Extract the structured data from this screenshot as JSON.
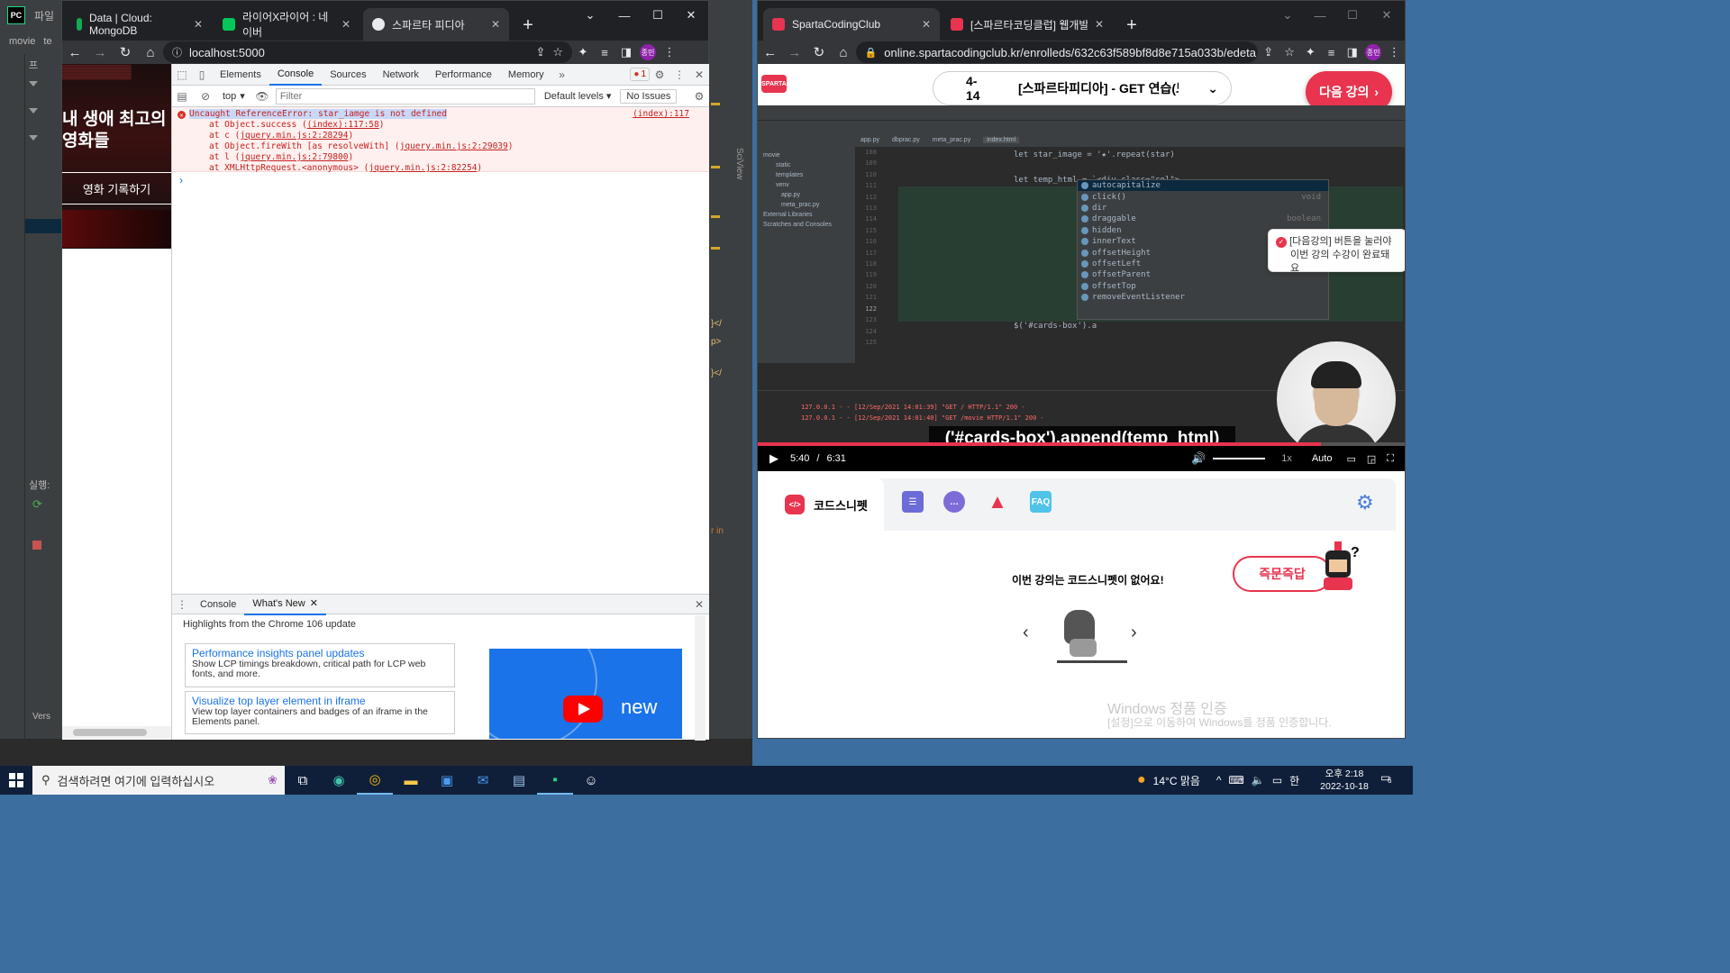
{
  "pycharm": {
    "title": "파일",
    "breadcrumb": "movie",
    "breadcrumb2": "te",
    "tree_item": "프",
    "run_label": "실행:",
    "sciview": "SciView",
    "version": "Vers"
  },
  "chrome_left": {
    "tabs": [
      {
        "label": "Data | Cloud: MongoDB",
        "favicon_color": "#13aa52"
      },
      {
        "label": "라이어X라이어 : 네이버",
        "favicon_color": "#03c75a"
      },
      {
        "label": "스파르타 피디아",
        "favicon_color": "#e8eaed",
        "active": true
      }
    ],
    "url": "localhost:5000",
    "profile": "종민",
    "page": {
      "hero_title": "내 생애 최고의 영화들",
      "hero_button": "영화 기록하기"
    },
    "devtools": {
      "tabs": [
        "Elements",
        "Console",
        "Sources",
        "Network",
        "Performance",
        "Memory"
      ],
      "active_tab": "Console",
      "error_count": "1",
      "context": "top",
      "filter_placeholder": "Filter",
      "levels": "Default levels",
      "issues": "No Issues",
      "error": {
        "message": "Uncaught ReferenceError: star_iamge is not defined",
        "location": "(index):117",
        "stack": [
          {
            "prefix": "at Object.success (",
            "link": "(index):117:58",
            "suffix": ")"
          },
          {
            "prefix": "at c (",
            "link": "jquery.min.js:2:28294",
            "suffix": ")"
          },
          {
            "prefix": "at Object.fireWith [as resolveWith] (",
            "link": "jquery.min.js:2:29039",
            "suffix": ")"
          },
          {
            "prefix": "at l (",
            "link": "jquery.min.js:2:79800",
            "suffix": ")"
          },
          {
            "prefix": "at XMLHttpRequest.<anonymous> (",
            "link": "jquery.min.js:2:82254",
            "suffix": ")"
          }
        ]
      },
      "drawer": {
        "tabs": [
          "Console",
          "What's New"
        ],
        "active_tab": "What's New",
        "heading": "Highlights from the Chrome 106 update",
        "cards": [
          {
            "title": "Performance insights panel updates",
            "body": "Show LCP timings breakdown, critical path for LCP web fonts, and more."
          },
          {
            "title": "Visualize top layer element in iframe",
            "body": "View top layer containers and badges of an iframe in the Elements panel."
          }
        ],
        "video_text": "new"
      }
    }
  },
  "chrome_right": {
    "tabs": [
      {
        "label": "SpartaCodingClub",
        "favicon_color": "#e8344e",
        "active": true
      },
      {
        "label": "[스파르타코딩클럽] 웹개발 종합",
        "favicon_color": "#e8344e"
      }
    ],
    "url": "online.spartacodingclub.kr/enrolleds/632c63f589bf8d8e715a033b/edeta...",
    "profile": "종민",
    "lecture": {
      "number": "4-14",
      "title": "[스파르타피디아] - GET 연습(보여",
      "next_button": "다음 강의",
      "tooltip_line1": "[다음강의] 버튼을 눌러야",
      "tooltip_line2": "이번 강의 수강이 완료돼요"
    },
    "video": {
      "subtitle": "('#cards-box').append(temp_html)",
      "current_time": "5:40",
      "duration": "6:31",
      "speed": "1x",
      "quality": "Auto",
      "progress": 0.87,
      "ide_tabs": [
        "app.py",
        "dbprac.py",
        "meta_prac.py",
        "index.html"
      ],
      "code_line1": "let star_image = '★'.repeat(star)",
      "code_line2": "let temp_html = `<div class=\"col\">",
      "code_line3": "$('#cards-box').a",
      "line_numbers": [
        "108",
        "109",
        "110",
        "111",
        "112",
        "113",
        "114",
        "115",
        "116",
        "117",
        "118",
        "119",
        "120",
        "121",
        "122",
        "123",
        "124",
        "125"
      ],
      "autocomplete": [
        {
          "name": "autocapitalize",
          "type": ""
        },
        {
          "name": "click()",
          "type": "void"
        },
        {
          "name": "dir",
          "type": ""
        },
        {
          "name": "draggable",
          "type": "boolean"
        },
        {
          "name": "hidden",
          "type": ""
        },
        {
          "name": "innerText",
          "type": "string"
        },
        {
          "name": "offsetHeight",
          "type": ""
        },
        {
          "name": "offsetLeft",
          "type": "number"
        },
        {
          "name": "offsetParent",
          "type": ""
        },
        {
          "name": "offsetTop",
          "type": ""
        },
        {
          "name": "removeEventListener",
          "type": ""
        }
      ],
      "run_log1": "127.0.0.1 - - [12/Sep/2021 14:01:39] \"GET / HTTP/1.1\" 200 -",
      "run_log2": "127.0.0.1 - - [12/Sep/2021 14:01:40] \"GET /movie HTTP/1.1\" 200 -",
      "tree": [
        "movie",
        "static",
        "templates",
        "venv",
        "app.py",
        "meta_prac.py",
        "External Libraries",
        "Scratches and Consoles"
      ]
    },
    "panel": {
      "active_tab": "코드스니펫",
      "empty_message": "이번 강의는 코드스니펫이 없어요!",
      "quick_answer": "즉문즉답",
      "faq": "FAQ"
    },
    "watermark_title": "Windows 정품 인증",
    "watermark_body": "[설정]으로 이동하여 Windows를 정품 인증합니다."
  },
  "taskbar": {
    "search_placeholder": "검색하려면 여기에 입력하십시오",
    "weather": "14°C 맑음",
    "ime": "한",
    "time": "오후 2:18",
    "date": "2022-10-18",
    "notifications": "6"
  }
}
